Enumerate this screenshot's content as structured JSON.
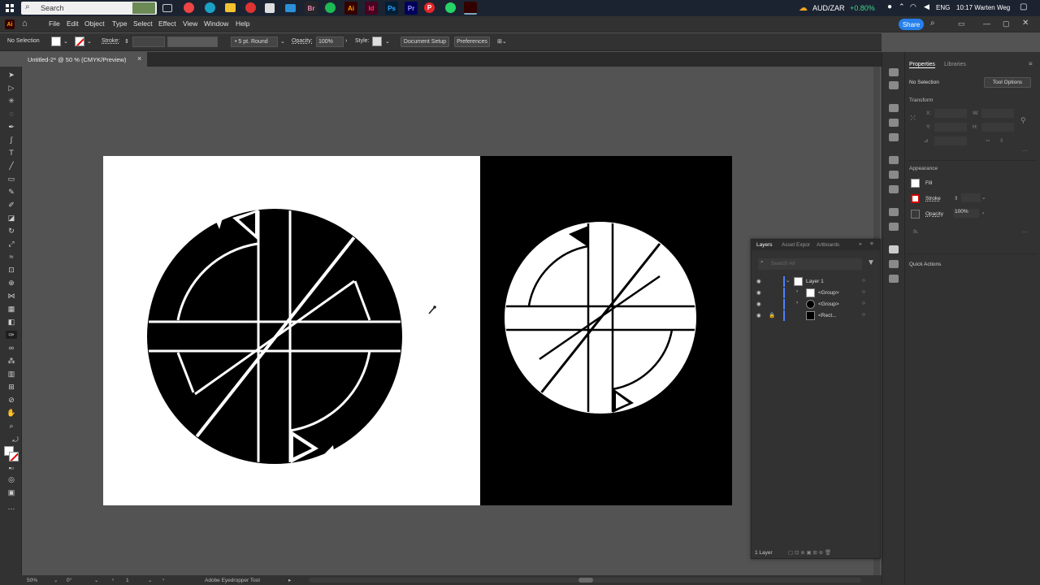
{
  "taskbar": {
    "search_placeholder": "Search",
    "ticker": "AUD/ZAR",
    "ticker_change": "+0.80%",
    "lang": "ENG",
    "clock": "10:17 Warten Weg",
    "apps": [
      "Br",
      "Ai",
      "Id",
      "Ps",
      "Pr",
      "P"
    ]
  },
  "menu": {
    "app": "Ai",
    "items": [
      "File",
      "Edit",
      "Object",
      "Type",
      "Select",
      "Effect",
      "View",
      "Window",
      "Help"
    ],
    "share": "Share"
  },
  "control": {
    "selection": "No Selection",
    "stroke_label": "Stroke:",
    "brush": "5 pt. Round",
    "opacity_label": "Opacity:",
    "opacity": "100%",
    "style_label": "Style:",
    "doc_setup": "Document Setup",
    "preferences": "Preferences"
  },
  "doc": {
    "tab": "Untitled-2* @ 50 % (CMYK/Preview)",
    "close": "×"
  },
  "status": {
    "zoom": "50%",
    "angle": "0°",
    "artboard": "1",
    "tool": "Adobe Eyedropper Tool"
  },
  "properties": {
    "tab_properties": "Properties",
    "tab_libraries": "Libraries",
    "selection": "No Selection",
    "tool_options": "Tool Options",
    "transform": "Transform",
    "x": "X:",
    "y": "Y:",
    "w": "W:",
    "h": "H:",
    "appearance": "Appearance",
    "fill": "Fill",
    "stroke": "Stroke",
    "opacity": "Opacity",
    "opacity_val": "100%",
    "fx": "fx.",
    "quick_actions": "Quick Actions"
  },
  "layers": {
    "tabs": [
      "Layers",
      "Asset Expor",
      "Artboards"
    ],
    "search_placeholder": "Search All",
    "items": [
      "Layer 1",
      "<Group>",
      "<Group>",
      "<Rect..."
    ],
    "footer": "1 Layer"
  },
  "colors": {
    "accent": "#2680eb",
    "bg": "#535353",
    "panel": "#323232"
  }
}
